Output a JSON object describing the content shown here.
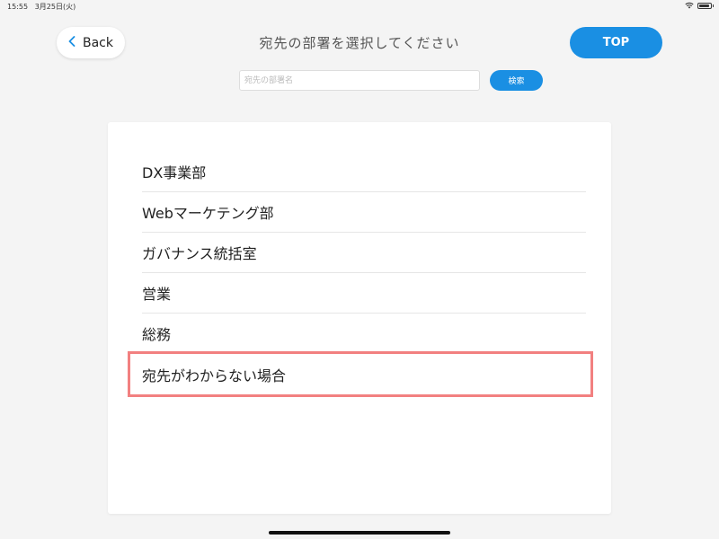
{
  "status_bar": {
    "time": "15:55",
    "date": "3月25日(火)"
  },
  "header": {
    "back_label": "Back",
    "title": "宛先の部署を選択してください",
    "top_label": "TOP"
  },
  "search": {
    "placeholder": "宛先の部署名",
    "button_label": "検索"
  },
  "departments": [
    "DX事業部",
    "Webマーケテング部",
    "ガバナンス統括室",
    "営業",
    "総務",
    "宛先がわからない場合"
  ],
  "colors": {
    "accent": "#1a8fe3",
    "highlight": "#f28080",
    "background": "#f4f4f4"
  },
  "icons": {
    "back": "chevron-left-icon",
    "wifi": "wifi-icon",
    "battery": "battery-icon"
  }
}
